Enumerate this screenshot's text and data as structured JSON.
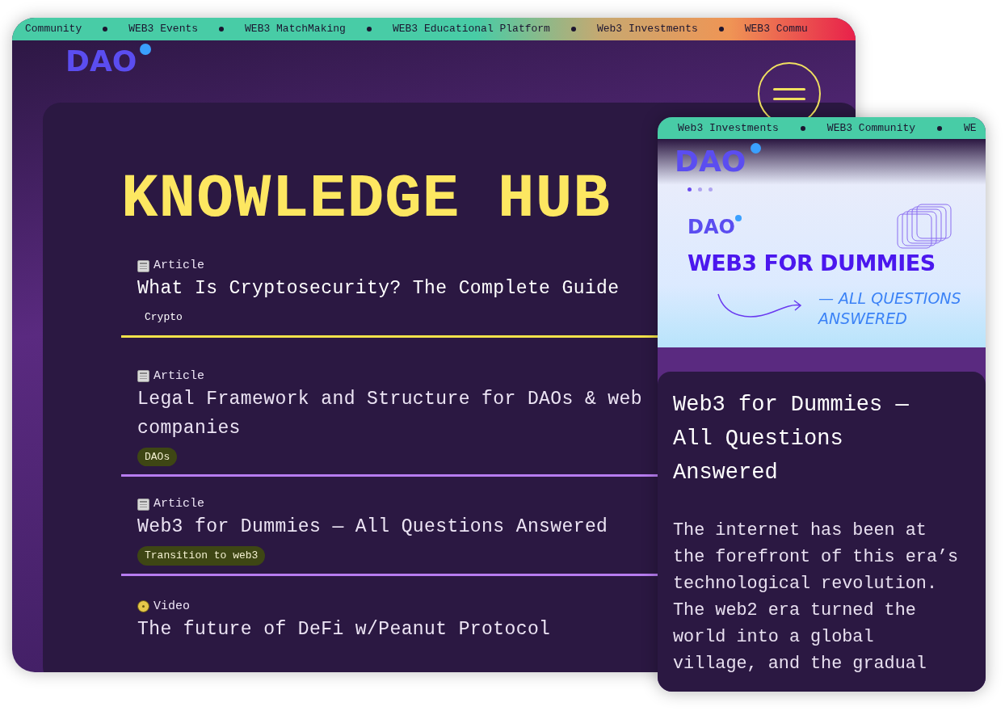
{
  "desktop": {
    "ticker": [
      "Community",
      "WEB3 Events",
      "WEB3 MatchMaking",
      "WEB3 Educational Platform",
      "Web3 Investments",
      "WEB3 Commu"
    ],
    "logo": "DAO",
    "heading": "KNOWLEDGE HUB",
    "items": [
      {
        "kind": "article",
        "type_label": "Article",
        "title": "What Is Cryptosecurity? The Complete Guide",
        "tag": "Crypto",
        "selected": true
      },
      {
        "kind": "article",
        "type_label": "Article",
        "title": "Legal Framework and Structure for DAOs & web companies",
        "tag": "DAOs",
        "selected": false
      },
      {
        "kind": "article",
        "type_label": "Article",
        "title": "Web3 for Dummies — All Questions Answered",
        "tag": "Transition to web3",
        "selected": false
      },
      {
        "kind": "video",
        "type_label": "Video",
        "title": "The future of DeFi w/Peanut Protocol",
        "selected": false
      }
    ]
  },
  "mobile": {
    "ticker": [
      "Web3 Investments",
      "WEB3 Community",
      "WE"
    ],
    "logo": "DAO",
    "banner": {
      "slides": [
        {
          "selected": true
        },
        {
          "selected": false
        },
        {
          "selected": false
        }
      ],
      "logo": "DAO",
      "title": "WEB3 FOR DUMMIES",
      "subtitle": "— ALL QUESTIONS ANSWERED"
    },
    "article_title": "Web3 for Dummies — All Questions Answered",
    "body": "The internet has been at the forefront of this era’s technological revolution. The web2 era turned the world into a global village, and the gradual"
  }
}
